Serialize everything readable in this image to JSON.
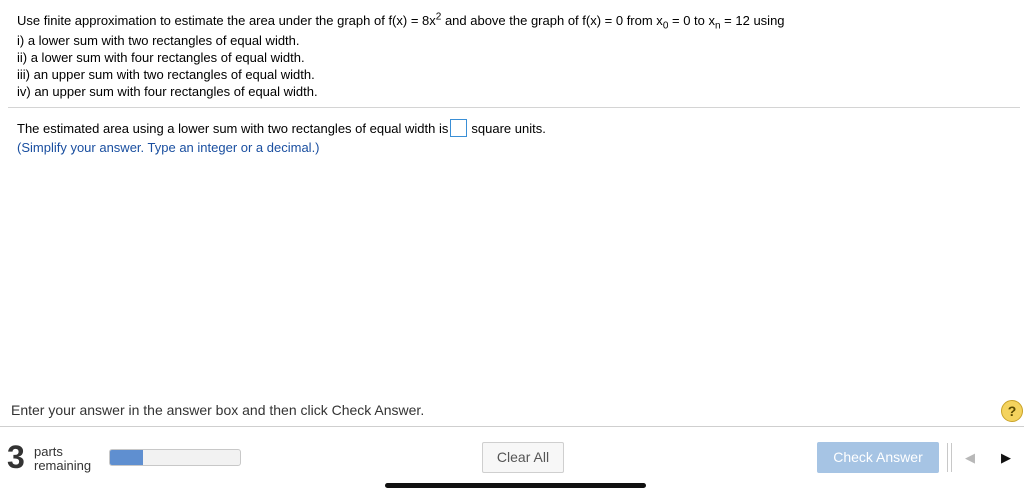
{
  "question": {
    "line1_a": "Use finite approximation to estimate the area under the graph of f(x) = 8x",
    "line1_exp": "2",
    "line1_b": " and above the graph of f(x) = 0 from x",
    "line1_sub0": "0",
    "line1_c": " = 0 to x",
    "line1_subn": "n",
    "line1_d": " = 12 using",
    "items": [
      "i) a lower sum with two rectangles of equal width.",
      "ii) a lower sum with four rectangles of equal width.",
      "iii) an upper sum with two rectangles of equal width.",
      "iv) an upper sum with four rectangles of equal width."
    ]
  },
  "answer": {
    "prefix": "The estimated area using a lower sum with two rectangles of equal width is",
    "value": "",
    "suffix": "square units.",
    "hint": "(Simplify your answer. Type an integer or a decimal.)"
  },
  "footer": {
    "instruction": "Enter your answer in the answer box and then click Check Answer.",
    "help_label": "?",
    "parts_count": "3",
    "parts_line1": "parts",
    "parts_line2": "remaining",
    "progress_fraction": 0.25,
    "clear_label": "Clear All",
    "check_label": "Check Answer"
  },
  "colors": {
    "accent": "#3a8fd6",
    "hint_text": "#1a4fa0",
    "progress_fill": "#5f8fd0",
    "check_button": "#a6c4e4",
    "help_icon": "#f4d35e"
  },
  "icons": {
    "help": "question-mark-icon",
    "prev": "triangle-left-icon",
    "next": "triangle-right-icon"
  }
}
